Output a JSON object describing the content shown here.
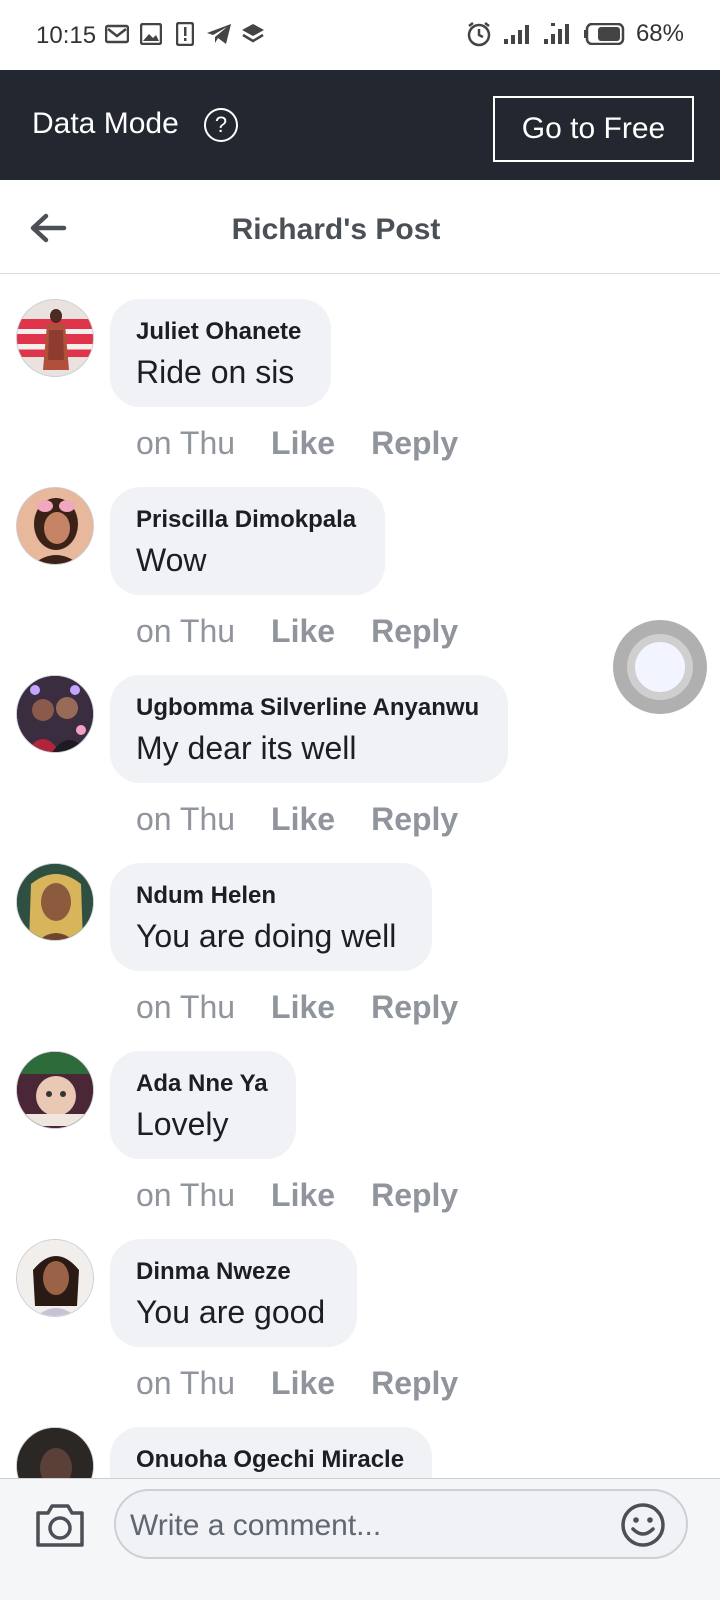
{
  "status_bar": {
    "time": "10:15",
    "left_icons": [
      "mail-icon",
      "image-icon",
      "sim-alert-icon",
      "telegram-icon",
      "layers-icon"
    ],
    "right_icons": [
      "alarm-icon",
      "signal-icon",
      "signal-icon-2",
      "battery-icon"
    ],
    "battery": "68%"
  },
  "banner": {
    "label": "Data Mode",
    "help_symbol": "?",
    "button_label": "Go to Free"
  },
  "header": {
    "title": "Richard's Post"
  },
  "comments": [
    {
      "author": "Juliet Ohanete",
      "text": "Ride on sis",
      "time": "on Thu",
      "like": "Like",
      "reply": "Reply"
    },
    {
      "author": "Priscilla Dimokpala",
      "text": "Wow",
      "time": "on Thu",
      "like": "Like",
      "reply": "Reply"
    },
    {
      "author": "Ugbomma Silverline Anyanwu",
      "text": "My dear its well",
      "time": "on Thu",
      "like": "Like",
      "reply": "Reply"
    },
    {
      "author": "Ndum Helen",
      "text": "You are doing well",
      "time": "on Thu",
      "like": "Like",
      "reply": "Reply"
    },
    {
      "author": "Ada Nne Ya",
      "text": "Lovely",
      "time": "on Thu",
      "like": "Like",
      "reply": "Reply"
    },
    {
      "author": "Dinma Nweze",
      "text": "You are good",
      "time": "on Thu",
      "like": "Like",
      "reply": "Reply"
    },
    {
      "author": "Onuoha Ogechi Miracle",
      "text": "",
      "time": "",
      "like": "",
      "reply": ""
    }
  ],
  "composer": {
    "placeholder": "Write a comment..."
  },
  "colors": {
    "banner_bg": "#23272f",
    "bubble_bg": "#f0f2f5",
    "action_gray": "#90949c"
  }
}
